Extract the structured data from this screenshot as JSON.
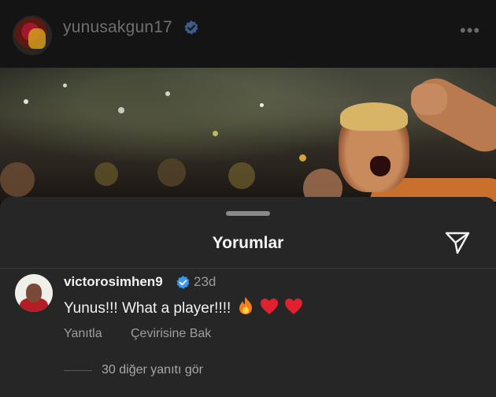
{
  "post": {
    "username": "yunusakgun17",
    "avatar_icon": "profile-photo",
    "verified_icon": "verified-badge-icon",
    "more_icon": "more-options-icon",
    "more_glyph": "•••"
  },
  "sheet": {
    "title": "Yorumlar",
    "share_icon": "send-icon"
  },
  "comment": {
    "username": "victorosimhen9",
    "verified_icon": "verified-badge-icon",
    "time": "23d",
    "text": "Yunus!!! What a player!!!!",
    "emojis": [
      "fire",
      "red-heart",
      "red-heart"
    ],
    "reply_label": "Yanıtla",
    "translate_label": "Çevirisine Bak",
    "view_replies_label": "30 diğer yanıtı gör"
  },
  "colors": {
    "background": "#101010",
    "sheet": "#262626",
    "verified": "#3897f0",
    "muted_text": "#9d9d9d",
    "heart": "#e0212f"
  }
}
